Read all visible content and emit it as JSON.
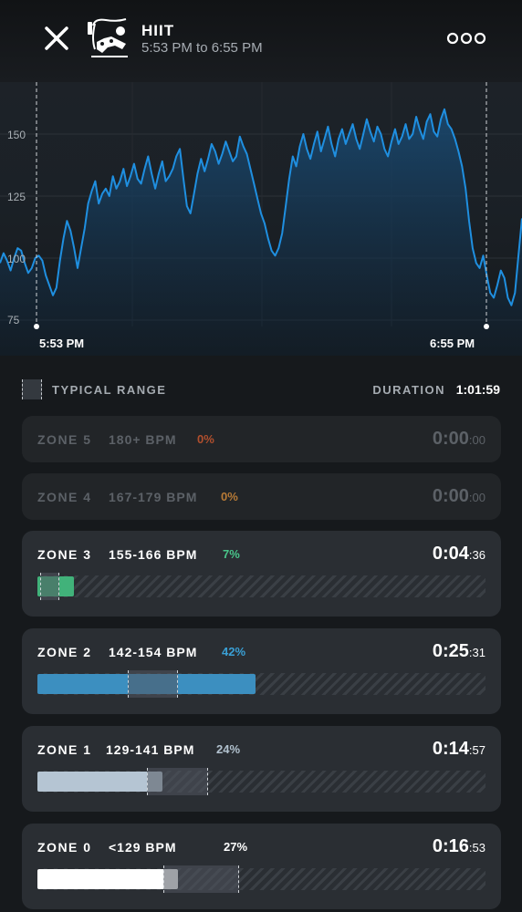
{
  "header": {
    "title": "HIIT",
    "subtitle": "5:53 PM to 6:55 PM"
  },
  "chart": {
    "y_ticks": [
      "150",
      "125",
      "100",
      "75"
    ],
    "start_label": "5:53 PM",
    "end_label": "6:55 PM",
    "line_color": "#1f8fe0"
  },
  "chart_data": {
    "type": "area",
    "ylim": [
      70,
      165
    ],
    "y_ticks": [
      75,
      100,
      125,
      150
    ],
    "x_start": "5:53 PM",
    "x_end": "6:55 PM",
    "values": [
      98,
      102,
      99,
      95,
      100,
      104,
      103,
      98,
      94,
      96,
      100,
      101,
      99,
      93,
      89,
      85,
      88,
      99,
      108,
      115,
      111,
      104,
      96,
      104,
      112,
      122,
      127,
      131,
      122,
      126,
      128,
      125,
      133,
      128,
      131,
      136,
      129,
      133,
      138,
      132,
      130,
      136,
      141,
      134,
      128,
      134,
      139,
      131,
      133,
      136,
      141,
      144,
      132,
      121,
      118,
      126,
      134,
      140,
      135,
      140,
      146,
      143,
      138,
      142,
      147,
      143,
      139,
      141,
      149,
      145,
      142,
      136,
      130,
      124,
      118,
      114,
      108,
      103,
      101,
      104,
      110,
      121,
      132,
      141,
      137,
      145,
      150,
      144,
      140,
      146,
      151,
      143,
      148,
      153,
      146,
      141,
      148,
      152,
      146,
      150,
      154,
      148,
      144,
      150,
      156,
      151,
      147,
      153,
      150,
      144,
      141,
      147,
      152,
      146,
      149,
      154,
      148,
      150,
      157,
      152,
      148,
      155,
      158,
      151,
      149,
      156,
      160,
      154,
      152,
      148,
      143,
      137,
      128,
      115,
      104,
      98,
      96,
      101,
      93,
      86,
      84,
      89,
      95,
      92,
      84,
      81,
      86,
      101,
      116
    ]
  },
  "legend": {
    "typical_range": "TYPICAL RANGE",
    "duration_label": "DURATION",
    "duration_value": "1:01:59"
  },
  "zones": [
    {
      "name": "ZONE 5",
      "bpm": "180+ BPM",
      "pct": "0%",
      "pct_color": "#b14f2d",
      "time_main": "0:00",
      "time_sec": ":00",
      "fill_color": "",
      "fill_fraction": 0,
      "dim": true
    },
    {
      "name": "ZONE 4",
      "bpm": "167-179 BPM",
      "pct": "0%",
      "pct_color": "#b77a36",
      "time_main": "0:00",
      "time_sec": ":00",
      "fill_color": "",
      "fill_fraction": 0,
      "dim": true
    },
    {
      "name": "ZONE 3",
      "bpm": "155-166 BPM",
      "pct": "7%",
      "pct_color": "#49c58a",
      "time_main": "0:04",
      "time_sec": ":36",
      "fill_color": "#41b27a",
      "fill_fraction": 0.07,
      "dim": false
    },
    {
      "name": "ZONE 2",
      "bpm": "142-154 BPM",
      "pct": "42%",
      "pct_color": "#3aa0d6",
      "time_main": "0:25",
      "time_sec": ":31",
      "fill_color": "#3c8fc0",
      "fill_fraction": 0.42,
      "dim": false
    },
    {
      "name": "ZONE 1",
      "bpm": "129-141 BPM",
      "pct": "24%",
      "pct_color": "#b2c2cf",
      "time_main": "0:14",
      "time_sec": ":57",
      "fill_color": "#b5c5d3",
      "fill_fraction": 0.24,
      "dim": false
    },
    {
      "name": "ZONE 0",
      "bpm": "<129 BPM",
      "pct": "27%",
      "pct_color": "#ffffff",
      "time_main": "0:16",
      "time_sec": ":53",
      "fill_color": "#ffffff",
      "fill_fraction": 0.27,
      "dim": false
    }
  ]
}
